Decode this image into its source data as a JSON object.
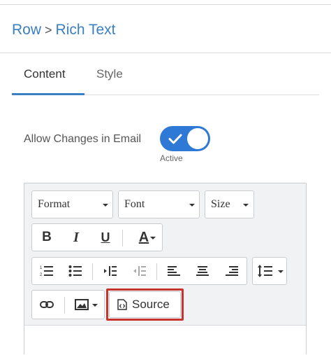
{
  "breadcrumb": {
    "parent": "Row",
    "separator": ">",
    "current": "Rich Text"
  },
  "tabs": [
    {
      "label": "Content",
      "active": true
    },
    {
      "label": "Style",
      "active": false
    }
  ],
  "toggle": {
    "label": "Allow Changes in Email",
    "state": "Active",
    "on": true
  },
  "toolbar": {
    "format_label": "Format",
    "font_label": "Font",
    "size_label": "Size",
    "bold": "B",
    "italic": "I",
    "underline": "U",
    "text_color": "A",
    "source_label": "Source"
  },
  "colors": {
    "accent": "#3a7fc2",
    "toggle_on": "#2f79d6",
    "highlight": "#c8332e"
  }
}
